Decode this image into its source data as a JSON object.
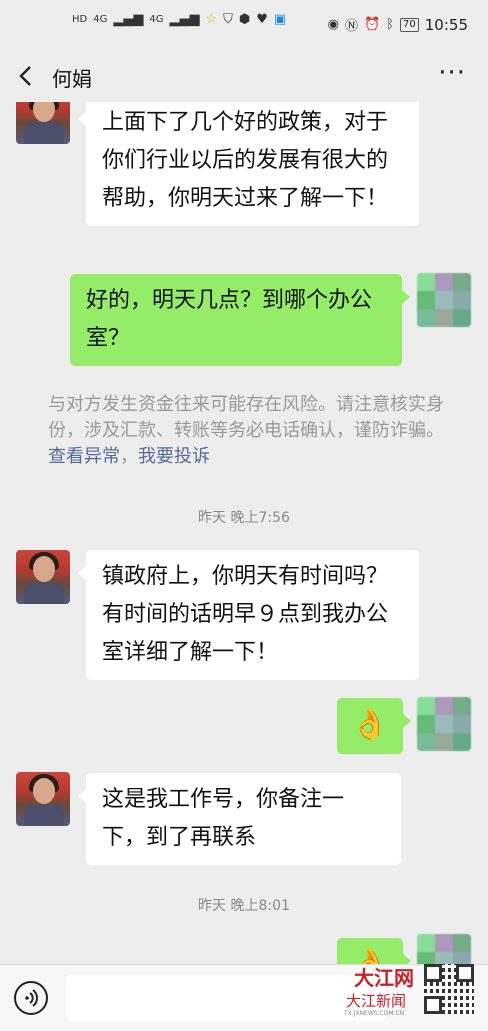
{
  "status_bar": {
    "hd1": "HD",
    "hd2": "HD",
    "net1": "4G",
    "net2": "4G",
    "battery": "70",
    "time": "10:55"
  },
  "nav": {
    "title": "何娟",
    "more": "···"
  },
  "messages": [
    {
      "side": "left",
      "text": "上面下了几个好的政策，对于你们行业以后的发展有很大的帮助，你明天过来了解一下！"
    },
    {
      "side": "right",
      "text": "好的，明天几点？到哪个办公室？"
    },
    {
      "side": "left",
      "text": "镇政府上，你明天有时间吗？有时间的话明早９点到我办公室详细了解一下！"
    },
    {
      "side": "right",
      "emoji": "👌"
    },
    {
      "side": "left",
      "text": "这是我工作号，你备注一下，到了再联系"
    },
    {
      "side": "right",
      "emoji": "👌"
    }
  ],
  "warning": {
    "text": "与对方发生资金往来可能存在风险。请注意核实身份，涉及汇款、转账等务必电话确认，谨防诈骗。",
    "link1": "查看异常",
    "sep": "，",
    "link2": "我要投诉"
  },
  "timestamps": [
    "昨天 晚上7:56",
    "昨天 晚上8:01"
  ],
  "watermark": {
    "line1": "大江网",
    "line2": "大江新闻",
    "sub": "TX.JXNEWS.COM.CN"
  },
  "colors": {
    "bubble_right": "#95ec69",
    "bubble_left": "#ffffff",
    "link": "#576b95",
    "background": "#ededed"
  }
}
